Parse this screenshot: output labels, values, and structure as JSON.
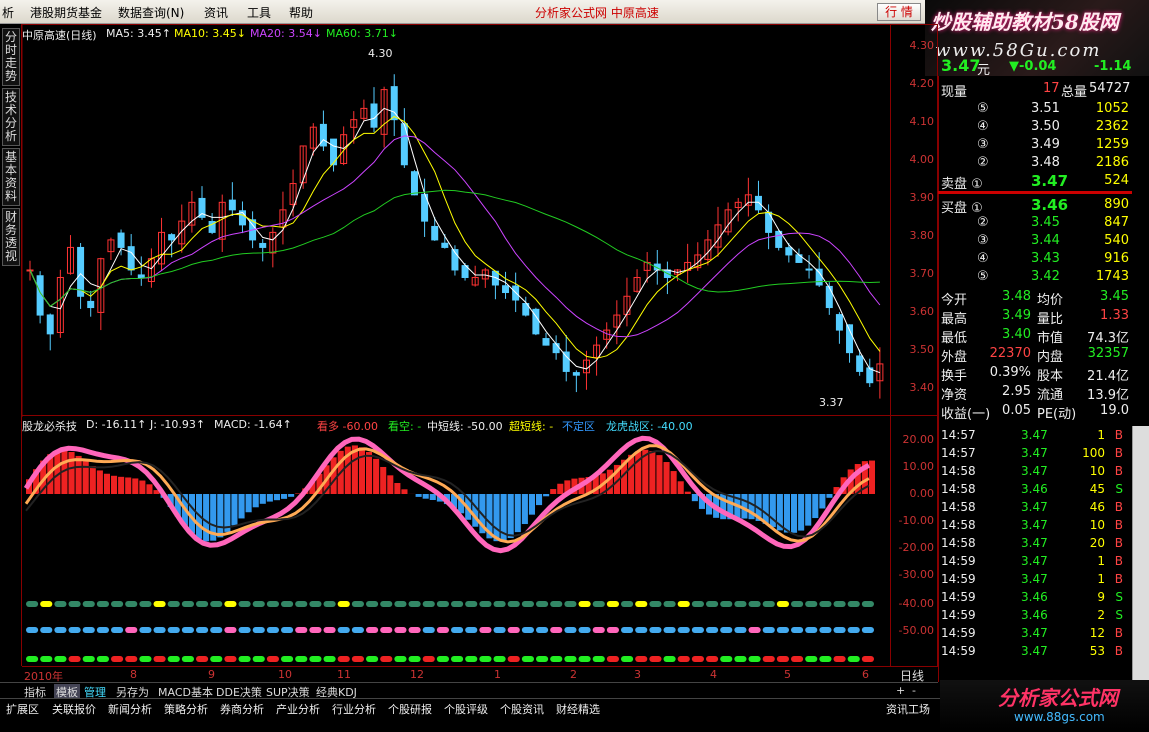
{
  "menubar": {
    "items": [
      "析",
      "港股期货基金",
      "数据查询(N)",
      "资讯",
      "工具",
      "帮助"
    ],
    "title": "分析家公式网 中原高速",
    "quote_btn": "行 情"
  },
  "brand": {
    "title": "炒股辅助教材58股网",
    "url": "www.58Gu.com"
  },
  "lefttabs": [
    "分时走势",
    "技术分析",
    "基本资料",
    "财务透视"
  ],
  "main_legend": {
    "name": "中原高速(日线)",
    "ma5": "MA5: 3.45↑",
    "ma10": "MA10: 3.45↓",
    "ma20": "MA20: 3.54↓",
    "ma60": "MA60: 3.71↓"
  },
  "main_axis": [
    "4.30",
    "4.20",
    "4.10",
    "4.00",
    "3.90",
    "3.80",
    "3.70",
    "3.60",
    "3.50",
    "3.40"
  ],
  "annotations": {
    "high": "4.30",
    "low": "3.37"
  },
  "sub_legend": {
    "name": "股龙必杀技",
    "d": "D: -16.11↑",
    "j": "J: -10.93↑",
    "macd": "MACD: -1.64↑",
    "kanduo": "看多 -60.00",
    "kankong": "看空: -",
    "zhongduan": "中短线: -50.00",
    "chaoduan": "超短线: -",
    "buding": "不定区",
    "longhu": "龙虎战区: -40.00"
  },
  "sub_axis": [
    "20.00",
    "10.00",
    "0.00",
    "-10.00",
    "-20.00",
    "-30.00",
    "-40.00",
    "-50.00"
  ],
  "dates": [
    "2010年",
    "8",
    "9",
    "10",
    "11",
    "12",
    "1",
    "2",
    "3",
    "4",
    "5",
    "6"
  ],
  "period": "日线",
  "tabbar1": [
    "指标",
    "模板",
    "管理",
    "另存为",
    "MACD基本",
    "DDE决策",
    "SUP决策",
    "经典KDJ"
  ],
  "tabbar2": [
    "扩展区",
    "关联报价",
    "新闻分析",
    "策略分析",
    "券商分析",
    "产业分析",
    "行业分析",
    "个股研报",
    "个股评级",
    "个股资讯",
    "财经精选",
    "资讯工场"
  ],
  "quote": {
    "price": "3.47",
    "unit": "元",
    "change": "▼-0.04",
    "pct": "-1.14",
    "xianliang_label": "现量",
    "xianliang": "17",
    "zongliang_label": "总量",
    "zongliang": "54727"
  },
  "sell": [
    {
      "lv": "⑤",
      "price": "3.51",
      "vol": "1052"
    },
    {
      "lv": "④",
      "price": "3.50",
      "vol": "2362"
    },
    {
      "lv": "③",
      "price": "3.49",
      "vol": "1259"
    },
    {
      "lv": "②",
      "price": "3.48",
      "vol": "2186"
    },
    {
      "lv": "卖盘 ①",
      "price": "3.47",
      "vol": "524"
    }
  ],
  "buy": [
    {
      "lv": "买盘 ①",
      "price": "3.46",
      "vol": "890"
    },
    {
      "lv": "②",
      "price": "3.45",
      "vol": "847"
    },
    {
      "lv": "③",
      "price": "3.44",
      "vol": "540"
    },
    {
      "lv": "④",
      "price": "3.43",
      "vol": "916"
    },
    {
      "lv": "⑤",
      "price": "3.42",
      "vol": "1743"
    }
  ],
  "stats": [
    [
      "今开",
      "3.48",
      "均价",
      "3.45"
    ],
    [
      "最高",
      "3.49",
      "量比",
      "1.33"
    ],
    [
      "最低",
      "3.40",
      "市值",
      "74.3亿"
    ],
    [
      "外盘",
      "22370",
      "内盘",
      "32357"
    ],
    [
      "换手",
      "0.39%",
      "股本",
      "21.4亿"
    ],
    [
      "净资",
      "2.95",
      "流通",
      "13.9亿"
    ],
    [
      "收益(一)",
      "0.05",
      "PE(动)",
      "19.0"
    ]
  ],
  "ticks": [
    [
      "14:57",
      "3.47",
      "1",
      "B"
    ],
    [
      "14:57",
      "3.47",
      "100",
      "B"
    ],
    [
      "14:58",
      "3.47",
      "10",
      "B"
    ],
    [
      "14:58",
      "3.46",
      "45",
      "S"
    ],
    [
      "14:58",
      "3.47",
      "46",
      "B"
    ],
    [
      "14:58",
      "3.47",
      "10",
      "B"
    ],
    [
      "14:58",
      "3.47",
      "20",
      "B"
    ],
    [
      "14:59",
      "3.47",
      "1",
      "B"
    ],
    [
      "14:59",
      "3.47",
      "1",
      "B"
    ],
    [
      "14:59",
      "3.46",
      "9",
      "S"
    ],
    [
      "14:59",
      "3.46",
      "2",
      "S"
    ],
    [
      "14:59",
      "3.47",
      "12",
      "B"
    ],
    [
      "14:59",
      "3.47",
      "53",
      "B"
    ]
  ],
  "logo": {
    "text": "分析家公式网",
    "url": "www.88gs.com"
  },
  "chart_data": {
    "type": "candlestick",
    "title": "中原高速(日线)",
    "ylim": [
      3.35,
      4.34
    ],
    "close": [
      3.72,
      3.6,
      3.55,
      3.7,
      3.78,
      3.65,
      3.62,
      3.75,
      3.8,
      3.78,
      3.72,
      3.7,
      3.75,
      3.82,
      3.8,
      3.85,
      3.9,
      3.86,
      3.82,
      3.9,
      3.88,
      3.84,
      3.8,
      3.78,
      3.82,
      3.88,
      3.95,
      4.05,
      4.1,
      4.05,
      4.0,
      4.08,
      4.12,
      4.15,
      4.1,
      4.2,
      4.12,
      4.0,
      3.92,
      3.85,
      3.8,
      3.78,
      3.72,
      3.7,
      3.7,
      3.72,
      3.68,
      3.66,
      3.64,
      3.6,
      3.55,
      3.52,
      3.5,
      3.45,
      3.44,
      3.48,
      3.52,
      3.56,
      3.6,
      3.65,
      3.7,
      3.74,
      3.72,
      3.7,
      3.72,
      3.74,
      3.76,
      3.8,
      3.84,
      3.88,
      3.9,
      3.92,
      3.88,
      3.82,
      3.78,
      3.76,
      3.74,
      3.72,
      3.68,
      3.62,
      3.56,
      3.5,
      3.45,
      3.42,
      3.47
    ]
  }
}
